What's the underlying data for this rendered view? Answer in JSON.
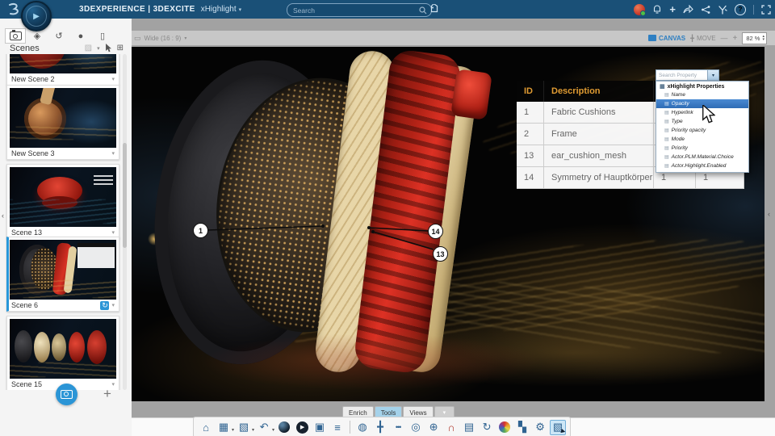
{
  "header": {
    "brand": "3DEXPERIENCE | 3DEXCITE",
    "app": "xHighlight",
    "search_placeholder": "Search"
  },
  "sidebar": {
    "title": "Scenes",
    "scenes": [
      {
        "label": "New Scene 2"
      },
      {
        "label": "New Scene 3"
      },
      {
        "label": "Scene 13"
      },
      {
        "label": "Scene 6"
      },
      {
        "label": "Scene 15"
      }
    ],
    "selected_scene": "Scene 6"
  },
  "canvas_toolbar": {
    "aspect_label": "Wide (16 : 9)",
    "canvas_label": "CANVAS",
    "move_label": "MOVE",
    "zoom_value": "82 %"
  },
  "canvas": {
    "callouts": [
      {
        "num": "1"
      },
      {
        "num": "14"
      },
      {
        "num": "13"
      }
    ],
    "table": {
      "col_id": "ID",
      "col_description": "Description",
      "rows": [
        {
          "id": "1",
          "description": "Fabric Cushions",
          "v1": "",
          "v2": ""
        },
        {
          "id": "2",
          "description": "Frame",
          "v1": "",
          "v2": ""
        },
        {
          "id": "13",
          "description": "ear_cushion_mesh",
          "v1": "",
          "v2": ""
        },
        {
          "id": "14",
          "description": "Symmetry of Hauptkörper",
          "v1": "1",
          "v2": "1"
        }
      ]
    },
    "property_dropdown": {
      "search_placeholder": "Search Property",
      "group_label": "xHighlight Properties",
      "items": [
        "Name",
        "Opacity",
        "Hyperlink",
        "Type",
        "Priority opacity",
        "Mode",
        "Priority",
        "Actor.PLM.Material.Choice",
        "Actor.Highlight.Enabled"
      ],
      "selected_item": "Opacity"
    }
  },
  "bottom": {
    "tabs": [
      "Enrich",
      "Tools",
      "Views"
    ],
    "active_tab": "Tools"
  },
  "icons": {
    "caret_down": "▾",
    "caret_up": "▴",
    "chevron_left": "‹",
    "home": "⌂",
    "save": "▦",
    "export3d": "▧",
    "undo": "↶",
    "play": "▶",
    "image_frame": "▣",
    "list": "≡",
    "material": "◍",
    "manipulator": "╋",
    "more_dots": "•••",
    "target": "◎",
    "globe": "⊕",
    "magnet": "∩",
    "grid": "▤",
    "rotate": "↻",
    "pattern": "▚",
    "gear": "⚙",
    "select": "▧",
    "shapes_tab": "◈",
    "history_tab": "↺",
    "sphere_tab": "●",
    "flag_tab": "▯",
    "image_placeholder": "▨",
    "grid_small": "⊞",
    "aspect": "▭",
    "minus": "—",
    "plus": "+",
    "question": "?"
  },
  "colors": {
    "topbar": "#1a5077",
    "accent_blue": "#2b95d6",
    "selection_blue": "#3d7ec9",
    "table_header_text": "#e09b32"
  }
}
